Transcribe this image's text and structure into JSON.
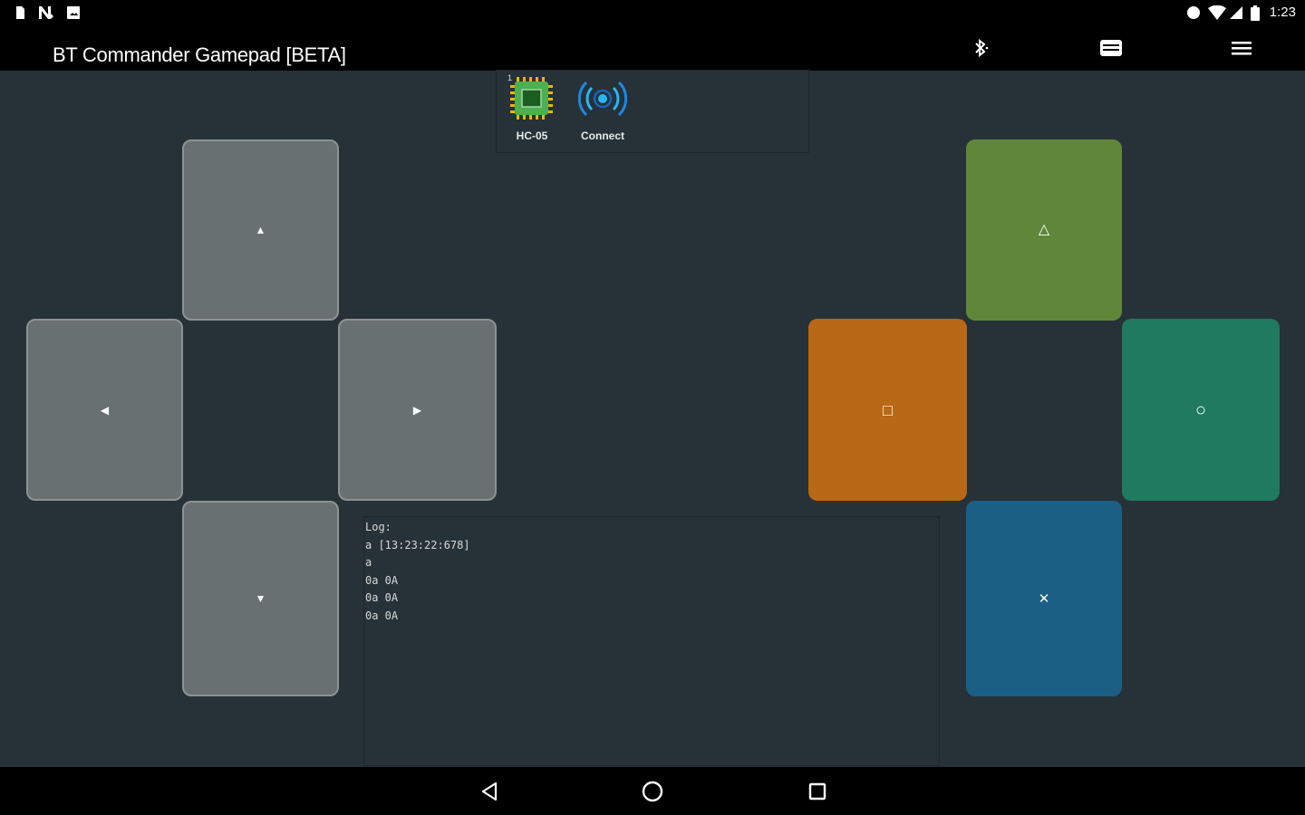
{
  "status_bar": {
    "time": "1:23",
    "left_icons": [
      "sd-card-icon",
      "n-logo-icon",
      "image-icon"
    ],
    "right_icons": [
      "circle-status-icon",
      "wifi-icon",
      "cell-signal-icon",
      "battery-icon"
    ]
  },
  "app_bar": {
    "title": "BT Commander Gamepad [BETA]",
    "actions": [
      "bluetooth-icon",
      "keyboard-icon",
      "menu-icon"
    ]
  },
  "device_panel": {
    "index": "1",
    "items": [
      {
        "label": "HC-05",
        "icon": "chip-icon"
      },
      {
        "label": "Connect",
        "icon": "broadcast-icon"
      }
    ]
  },
  "dpad": {
    "up": "▲",
    "left": "◀",
    "right": "▶",
    "down": "▼"
  },
  "action_buttons": {
    "triangle": "△",
    "square": "□",
    "circle": "○",
    "cross": "✕",
    "colors": {
      "triangle": "#5f8639",
      "square": "#b86816",
      "circle": "#1f7a5f",
      "cross": "#1b5f85"
    }
  },
  "log": {
    "lines": [
      "Log:",
      "a [13:23:22:678]",
      "a",
      "0a 0A",
      "0a 0A",
      "0a 0A"
    ]
  },
  "nav_bar": {
    "buttons": [
      "back-icon",
      "home-icon",
      "recents-icon"
    ]
  }
}
